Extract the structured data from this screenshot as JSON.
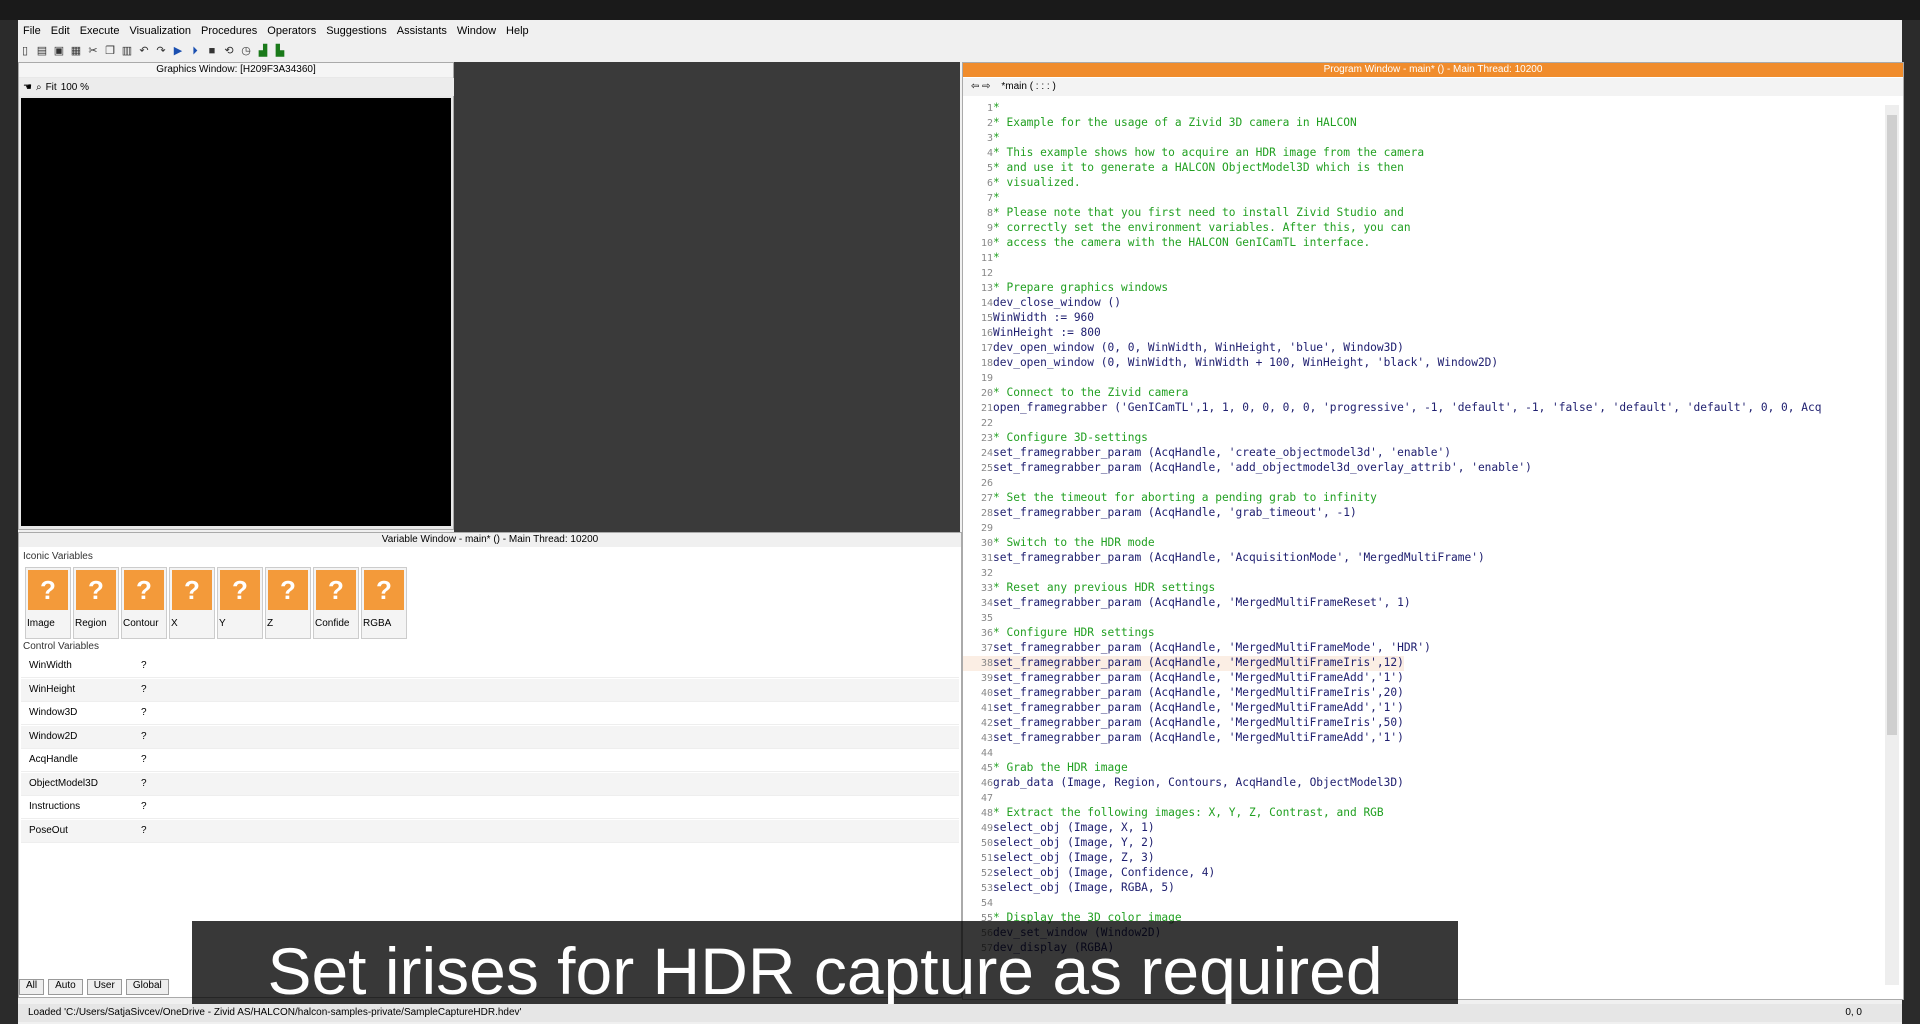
{
  "menu": [
    "File",
    "Edit",
    "Execute",
    "Visualization",
    "Procedures",
    "Operators",
    "Suggestions",
    "Assistants",
    "Window",
    "Help"
  ],
  "graphics_window": {
    "title": "Graphics Window: [H209F3A34360]",
    "fit_label": "Fit",
    "zoom": "100 %"
  },
  "variable_window": {
    "title": "Variable Window - main* () - Main Thread: 10200",
    "iconic_label": "Iconic Variables",
    "control_label": "Control Variables",
    "iconic": [
      "Image",
      "Region",
      "Contour",
      "X",
      "Y",
      "Z",
      "Confide",
      "RGBA"
    ],
    "control": [
      {
        "name": "WinWidth",
        "value": "?"
      },
      {
        "name": "WinHeight",
        "value": "?"
      },
      {
        "name": "Window3D",
        "value": "?"
      },
      {
        "name": "Window2D",
        "value": "?"
      },
      {
        "name": "AcqHandle",
        "value": "?"
      },
      {
        "name": "ObjectModel3D",
        "value": "?"
      },
      {
        "name": "Instructions",
        "value": "?"
      },
      {
        "name": "PoseOut",
        "value": "?"
      }
    ],
    "tabs": [
      "All",
      "Auto",
      "User",
      "Global"
    ]
  },
  "program_window": {
    "title": "Program Window - main* () - Main Thread: 10200",
    "tab": "*main ( : : : )",
    "lines": [
      {
        "n": "1",
        "t": "*",
        "c": "cm"
      },
      {
        "n": "2",
        "t": "* Example for the usage of a Zivid 3D camera in HALCON",
        "c": "cm"
      },
      {
        "n": "3",
        "t": "*",
        "c": "cm"
      },
      {
        "n": "4",
        "t": "* This example shows how to acquire an HDR image from the camera",
        "c": "cm"
      },
      {
        "n": "5",
        "t": "* and use it to generate a HALCON ObjectModel3D which is then",
        "c": "cm"
      },
      {
        "n": "6",
        "t": "* visualized.",
        "c": "cm"
      },
      {
        "n": "7",
        "t": "*",
        "c": "cm"
      },
      {
        "n": "8",
        "t": "* Please note that you first need to install Zivid Studio and",
        "c": "cm"
      },
      {
        "n": "9",
        "t": "* correctly set the environment variables. After this, you can",
        "c": "cm"
      },
      {
        "n": "10",
        "t": "* access the camera with the HALCON GenICamTL interface.",
        "c": "cm"
      },
      {
        "n": "11",
        "t": "*",
        "c": "cm"
      },
      {
        "n": "12",
        "t": "",
        "c": "cd"
      },
      {
        "n": "13",
        "t": "* Prepare graphics windows",
        "c": "cm"
      },
      {
        "n": "14",
        "t": "dev_close_window ()",
        "c": "cd"
      },
      {
        "n": "15",
        "t": "WinWidth := 960",
        "c": "cd"
      },
      {
        "n": "16",
        "t": "WinHeight := 800",
        "c": "cd"
      },
      {
        "n": "17",
        "t": "dev_open_window (0, 0, WinWidth, WinHeight, 'blue', Window3D)",
        "c": "cd"
      },
      {
        "n": "18",
        "t": "dev_open_window (0, WinWidth, WinWidth + 100, WinHeight, 'black', Window2D)",
        "c": "cd"
      },
      {
        "n": "19",
        "t": "",
        "c": "cd"
      },
      {
        "n": "20",
        "t": "* Connect to the Zivid camera",
        "c": "cm"
      },
      {
        "n": "21",
        "t": "open_framegrabber ('GenICamTL',1, 1, 0, 0, 0, 0, 'progressive', -1, 'default', -1, 'false', 'default', 'default', 0, 0, Acq",
        "c": "cd"
      },
      {
        "n": "22",
        "t": "",
        "c": "cd"
      },
      {
        "n": "23",
        "t": "* Configure 3D-settings",
        "c": "cm"
      },
      {
        "n": "24",
        "t": "set_framegrabber_param (AcqHandle, 'create_objectmodel3d', 'enable')",
        "c": "cd"
      },
      {
        "n": "25",
        "t": "set_framegrabber_param (AcqHandle, 'add_objectmodel3d_overlay_attrib', 'enable')",
        "c": "cd"
      },
      {
        "n": "26",
        "t": "",
        "c": "cd"
      },
      {
        "n": "27",
        "t": "* Set the timeout for aborting a pending grab to infinity",
        "c": "cm"
      },
      {
        "n": "28",
        "t": "set_framegrabber_param (AcqHandle, 'grab_timeout', -1)",
        "c": "cd"
      },
      {
        "n": "29",
        "t": "",
        "c": "cd"
      },
      {
        "n": "30",
        "t": "* Switch to the HDR mode",
        "c": "cm"
      },
      {
        "n": "31",
        "t": "set_framegrabber_param (AcqHandle, 'AcquisitionMode', 'MergedMultiFrame')",
        "c": "cd"
      },
      {
        "n": "32",
        "t": "",
        "c": "cd"
      },
      {
        "n": "33",
        "t": "* Reset any previous HDR settings",
        "c": "cm"
      },
      {
        "n": "34",
        "t": "set_framegrabber_param (AcqHandle, 'MergedMultiFrameReset', 1)",
        "c": "cd"
      },
      {
        "n": "35",
        "t": "",
        "c": "cd"
      },
      {
        "n": "36",
        "t": "* Configure HDR settings",
        "c": "cm"
      },
      {
        "n": "37",
        "t": "set_framegrabber_param (AcqHandle, 'MergedMultiFrameMode', 'HDR')",
        "c": "cd"
      },
      {
        "n": "38",
        "t": "set_framegrabber_param (AcqHandle, 'MergedMultiFrameIris',12)",
        "c": "cd"
      },
      {
        "n": "39",
        "t": "set_framegrabber_param (AcqHandle, 'MergedMultiFrameAdd','1')",
        "c": "cd"
      },
      {
        "n": "40",
        "t": "set_framegrabber_param (AcqHandle, 'MergedMultiFrameIris',20)",
        "c": "cd"
      },
      {
        "n": "41",
        "t": "set_framegrabber_param (AcqHandle, 'MergedMultiFrameAdd','1')",
        "c": "cd"
      },
      {
        "n": "42",
        "t": "set_framegrabber_param (AcqHandle, 'MergedMultiFrameIris',50)",
        "c": "cd"
      },
      {
        "n": "43",
        "t": "set_framegrabber_param (AcqHandle, 'MergedMultiFrameAdd','1')",
        "c": "cd"
      },
      {
        "n": "44",
        "t": "",
        "c": "cd"
      },
      {
        "n": "45",
        "t": "* Grab the HDR image",
        "c": "cm"
      },
      {
        "n": "46",
        "t": "grab_data (Image, Region, Contours, AcqHandle, ObjectModel3D)",
        "c": "cd"
      },
      {
        "n": "47",
        "t": "",
        "c": "cd"
      },
      {
        "n": "48",
        "t": "* Extract the following images: X, Y, Z, Contrast, and RGB",
        "c": "cm"
      },
      {
        "n": "49",
        "t": "select_obj (Image, X, 1)",
        "c": "cd"
      },
      {
        "n": "50",
        "t": "select_obj (Image, Y, 2)",
        "c": "cd"
      },
      {
        "n": "51",
        "t": "select_obj (Image, Z, 3)",
        "c": "cd"
      },
      {
        "n": "52",
        "t": "select_obj (Image, Confidence, 4)",
        "c": "cd"
      },
      {
        "n": "53",
        "t": "select_obj (Image, RGBA, 5)",
        "c": "cd"
      },
      {
        "n": "54",
        "t": "",
        "c": "cd"
      },
      {
        "n": "55",
        "t": "* Display the 3D color image",
        "c": "cm"
      },
      {
        "n": "56",
        "t": "dev_set_window (Window2D)",
        "c": "cd"
      },
      {
        "n": "57",
        "t": "dev_display (RGBA)",
        "c": "cd"
      }
    ]
  },
  "subtitle": "Set irises for HDR capture as required",
  "status": "Loaded 'C:/Users/SatjaSivcev/OneDrive - Zivid AS/HALCON/halcon-samples-private/SampleCaptureHDR.hdev'",
  "status_right": "0, 0",
  "accent_color": "#f08c2c"
}
